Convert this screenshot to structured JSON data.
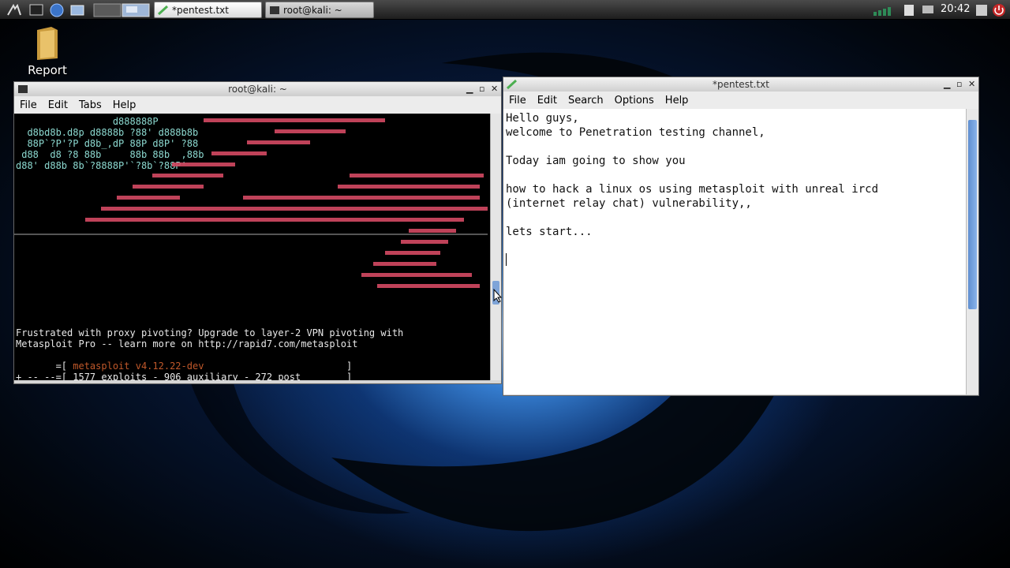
{
  "taskbar": {
    "clock": "20:42",
    "tasks": [
      {
        "label": "*pentest.txt",
        "icon": "text-editor-icon"
      },
      {
        "label": "root@kali: ~",
        "icon": "terminal-icon"
      }
    ]
  },
  "desktop": {
    "icons": [
      {
        "label": "Report",
        "icon": "folder-icon"
      }
    ]
  },
  "terminal": {
    "title": "root@kali: ~",
    "menu": [
      "File",
      "Edit",
      "Tabs",
      "Help"
    ],
    "banner_lines": [
      {
        "color": "g",
        "text": "                 d888888P       "
      },
      {
        "color": "g",
        "text": "  d8bd8b.d8p d8888b ?88' d888b8b          "
      },
      {
        "color": "g",
        "text": "  88P`?P'?P d8b_,dP 88P d8P' ?88         "
      },
      {
        "color": "g",
        "text": " d88  d8 ?8 88b     88b 88b  ,88b "
      },
      {
        "color": "g",
        "text": "d88' d88b 8b`?8888P'`?8b`?88P'"
      }
    ],
    "tagline_1": "Frustrated with proxy pivoting? Upgrade to layer-2 VPN pivoting with",
    "tagline_2": "Metasploit Pro -- learn more on http://rapid7.com/metasploit",
    "version_prefix": "       =[ ",
    "version": "metasploit v4.12.22-dev",
    "version_suffix": "                         ]",
    "stats": "+ -- --=[ 1577 exploits - 906 auxiliary - 272 post        ]"
  },
  "editor": {
    "title": "*pentest.txt",
    "menu": [
      "File",
      "Edit",
      "Search",
      "Options",
      "Help"
    ],
    "lines": [
      "Hello guys,",
      "welcome to Penetration testing channel,",
      "",
      "Today iam going to show you",
      "",
      "how to hack a linux os using metasploit with unreal ircd",
      "(internet relay chat) vulnerability,,",
      "",
      "lets start..."
    ]
  },
  "colors": {
    "terminal_green": "#8cd9d0",
    "terminal_red": "#d44a63",
    "terminal_orange": "#c0582a"
  }
}
